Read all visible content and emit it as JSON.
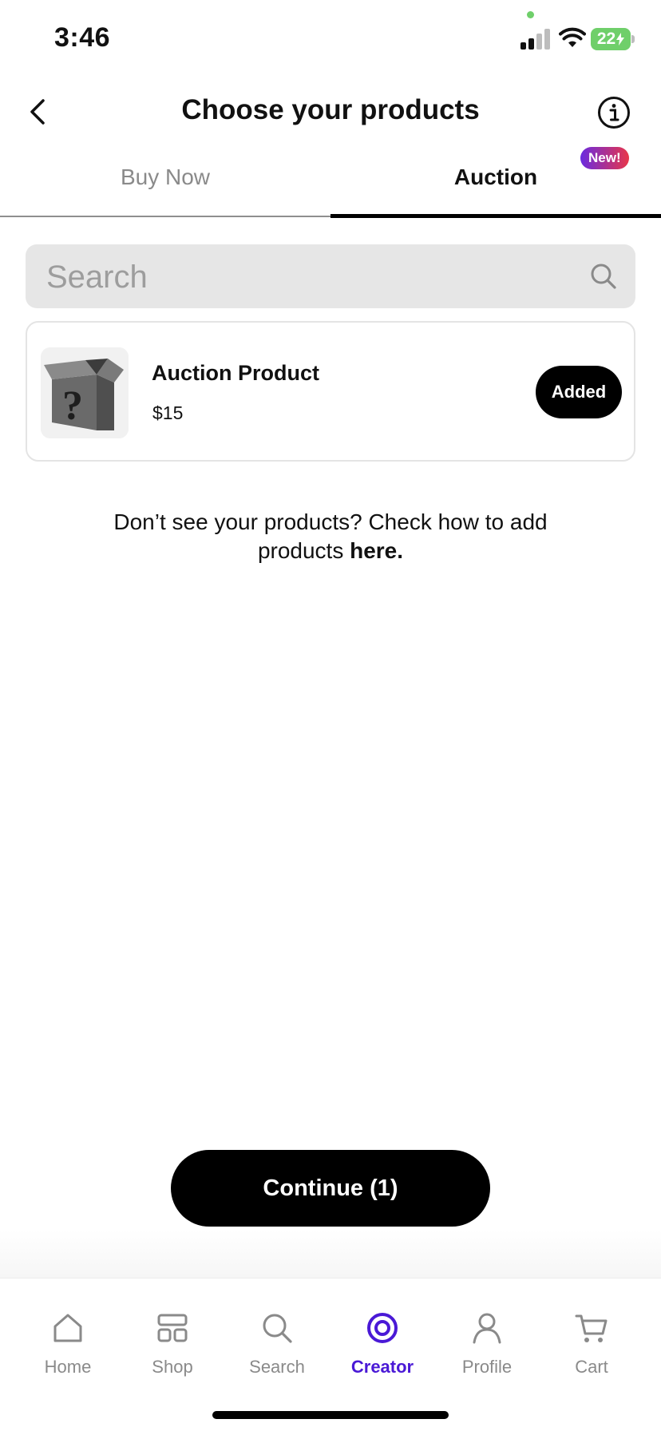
{
  "status_bar": {
    "time": "3:46",
    "battery_level": "22",
    "battery_color": "#6fcf6a",
    "privacy_dot_color": "#6fcf6a"
  },
  "header": {
    "title": "Choose your products",
    "back_icon": "chevron-left-icon",
    "info_icon": "info-circle-icon"
  },
  "tabs": {
    "items": [
      {
        "label": "Buy Now",
        "active": false
      },
      {
        "label": "Auction",
        "active": true
      }
    ],
    "badge": "New!"
  },
  "search": {
    "placeholder": "Search",
    "value": "",
    "icon": "search-icon"
  },
  "products": [
    {
      "name": "Auction Product",
      "price": "$15",
      "image_icon": "mystery-box-icon",
      "button_label": "Added"
    }
  ],
  "help": {
    "text": "Don’t see your products? Check how to add products ",
    "link": "here."
  },
  "continue_button": {
    "label": "Continue (1)"
  },
  "bottom_nav": {
    "items": [
      {
        "label": "Home",
        "icon": "home-icon",
        "active": false
      },
      {
        "label": "Shop",
        "icon": "shop-grid-icon",
        "active": false
      },
      {
        "label": "Search",
        "icon": "search-icon",
        "active": false
      },
      {
        "label": "Creator",
        "icon": "creator-icon",
        "active": true
      },
      {
        "label": "Profile",
        "icon": "profile-icon",
        "active": false
      },
      {
        "label": "Cart",
        "icon": "cart-icon",
        "active": false
      }
    ]
  },
  "colors": {
    "accent": "#4a19d6",
    "badge_gradient_start": "#6a2be0",
    "badge_gradient_end": "#e8364a",
    "primary_button": "#000000"
  }
}
